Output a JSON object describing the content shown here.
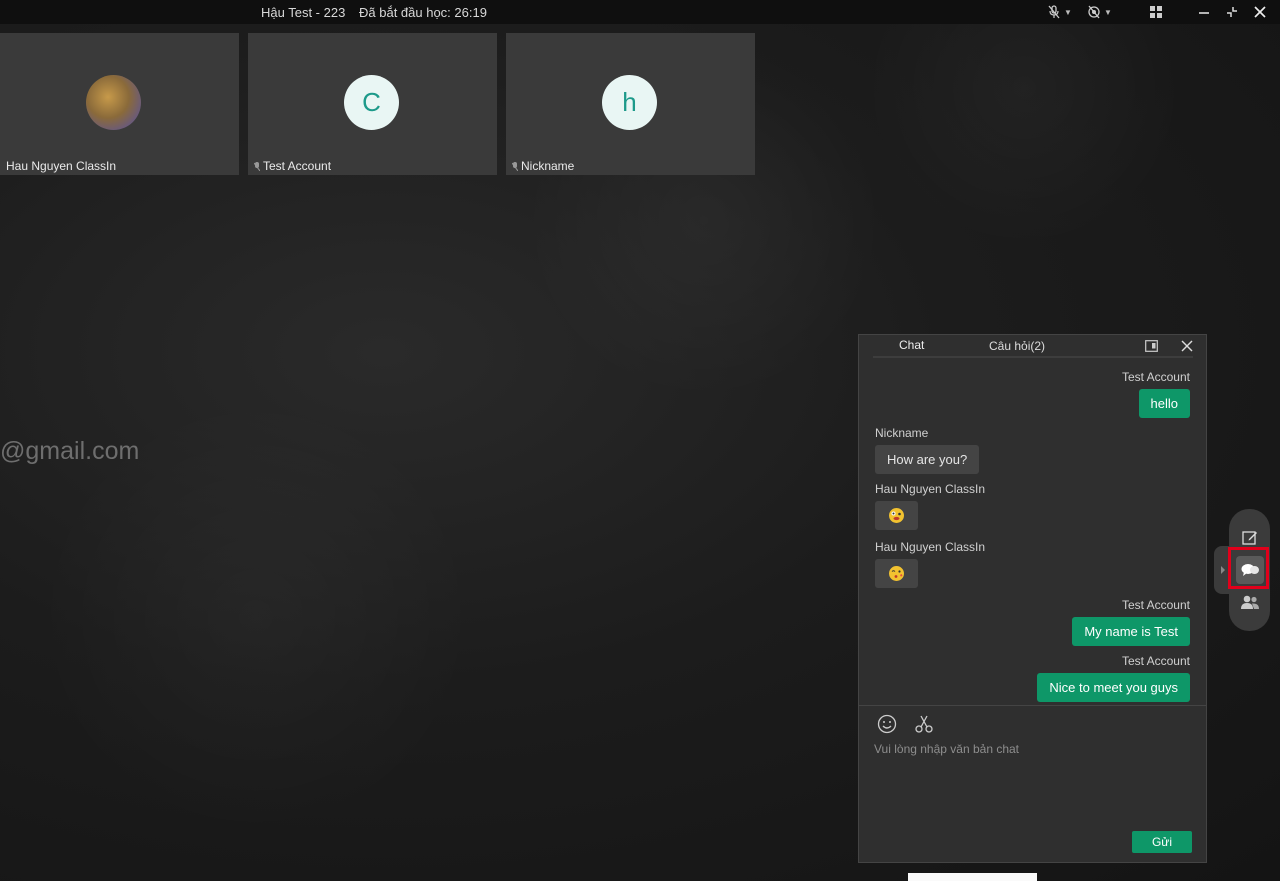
{
  "topbar": {
    "title": "Hậu Test - 223",
    "elapsed": "Đã bắt đầu học: 26:19"
  },
  "participants": [
    {
      "name": "Hau Nguyen ClassIn",
      "initial": "",
      "avatar": "cat-photo"
    },
    {
      "name": "Test Account",
      "initial": "C",
      "avatar": "letter"
    },
    {
      "name": "Nickname",
      "initial": "h",
      "avatar": "letter"
    }
  ],
  "board": {
    "email_fragment": "@gmail.com"
  },
  "chat": {
    "tab_chat": "Chat",
    "tab_questions": "Câu hỏi(2)",
    "messages": [
      {
        "sender": "Test Account",
        "text": "hello",
        "mine": true
      },
      {
        "sender": "Nickname",
        "text": "How are you?",
        "mine": false
      },
      {
        "sender": "Hau Nguyen ClassIn",
        "text": "",
        "emoji": "crazy-face",
        "mine": false
      },
      {
        "sender": "Hau Nguyen ClassIn",
        "text": "",
        "emoji": "kiss-face",
        "mine": false
      },
      {
        "sender": "Test Account",
        "text": "My name is Test",
        "mine": true
      },
      {
        "sender": "Test Account",
        "text": "Nice to meet you guys",
        "mine": true
      }
    ],
    "input_placeholder": "Vui lòng nhập văn bản chat",
    "send_label": "Gửi"
  },
  "colors": {
    "accent": "#0e9768",
    "highlight": "#e1001b",
    "avatar_bg": "#e9f6f4",
    "avatar_text": "#1d9a8a"
  }
}
